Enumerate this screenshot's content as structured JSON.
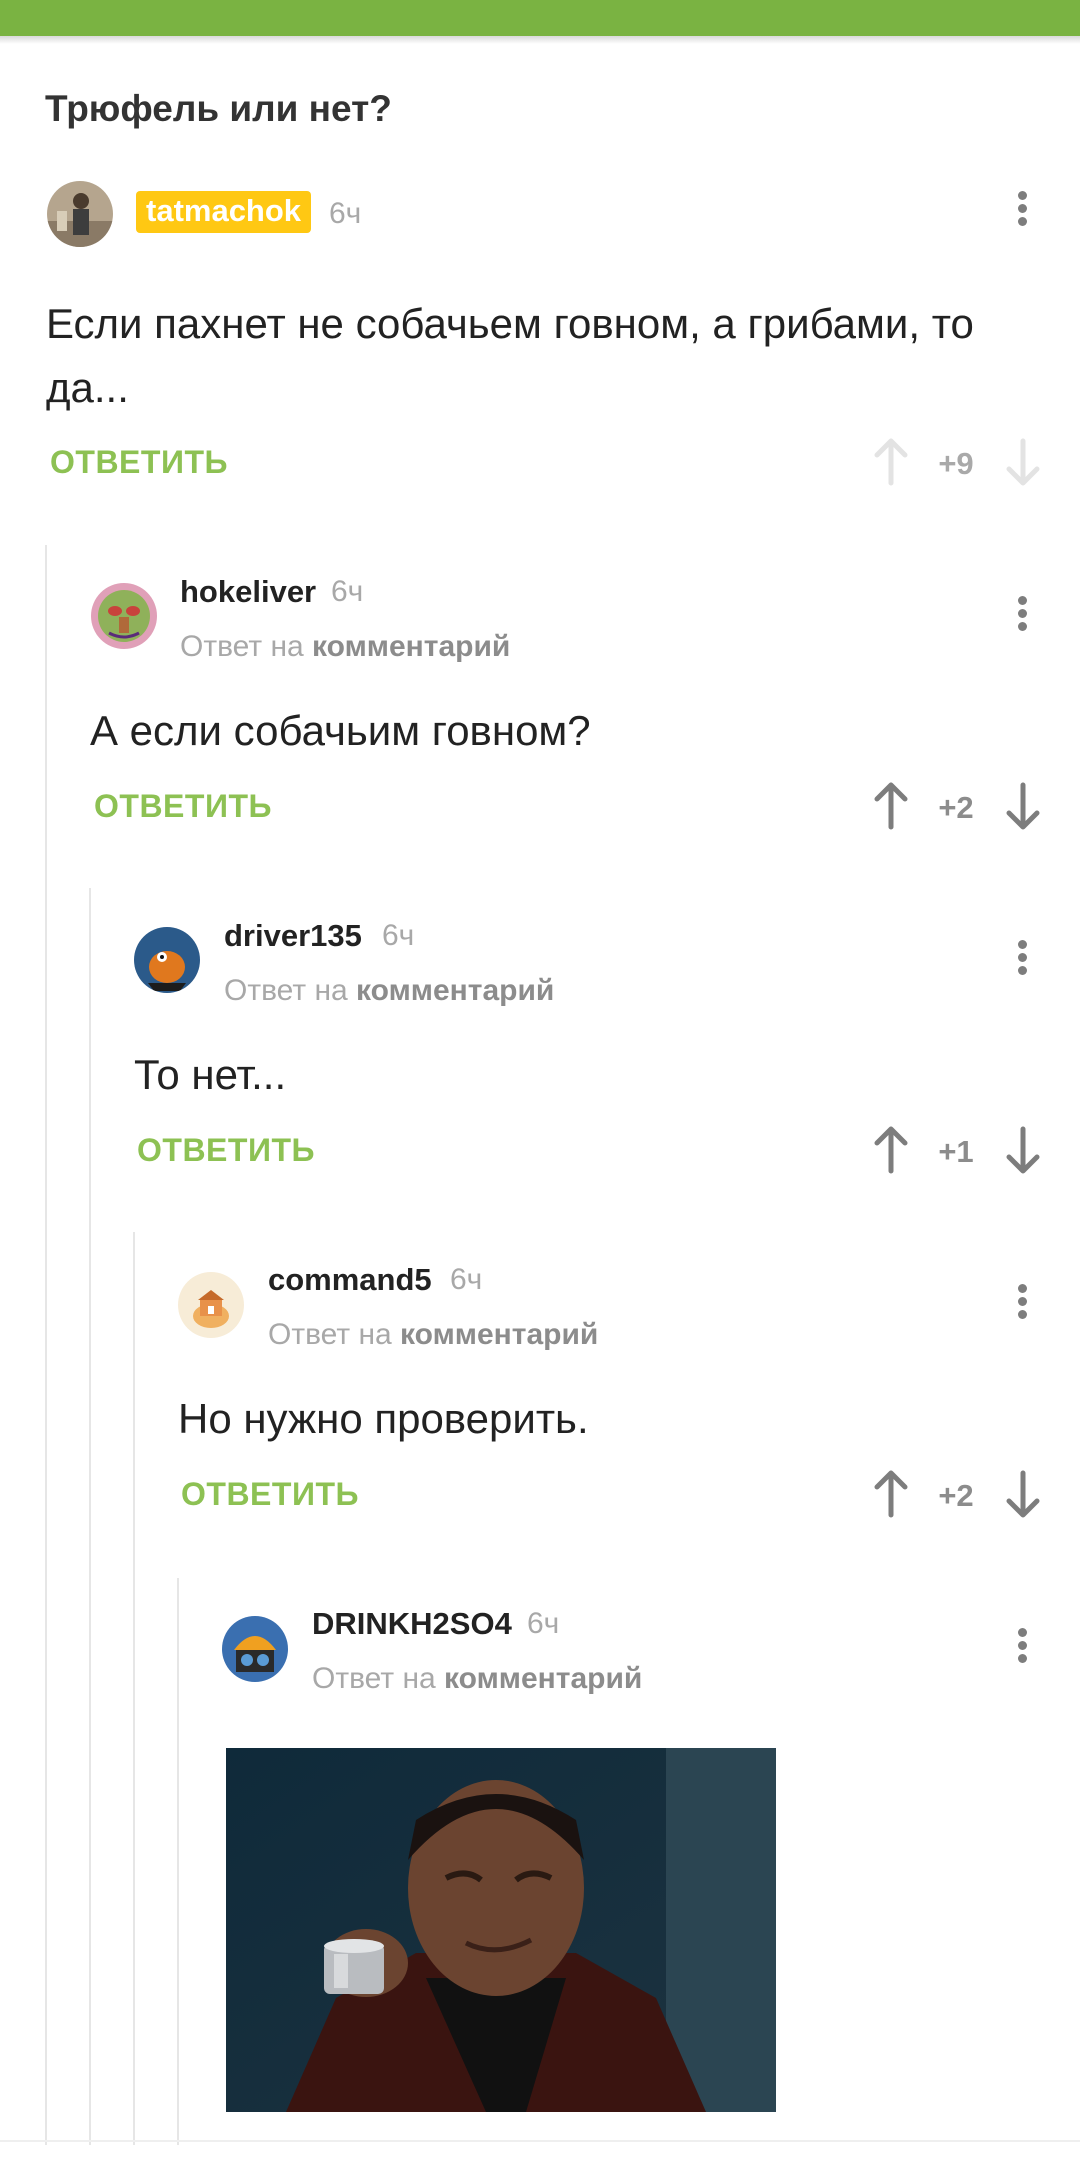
{
  "post": {
    "title": "Трюфель или нет?"
  },
  "comments": [
    {
      "author": "tatmachok",
      "time": "6ч",
      "text": "Если пахнет не собачьем говном, а грибами, то да...",
      "reply_label": "ОТВЕТИТЬ",
      "score": "+9"
    },
    {
      "author": "hokeliver",
      "time": "6ч",
      "reply_to_prefix": "Ответ на",
      "reply_to_link": "комментарий",
      "text": "А если собачьим говном?",
      "reply_label": "ОТВЕТИТЬ",
      "score": "+2"
    },
    {
      "author": "driver135",
      "time": "6ч",
      "reply_to_prefix": "Ответ на",
      "reply_to_link": "комментарий",
      "text": "То нет...",
      "reply_label": "ОТВЕТИТЬ",
      "score": "+1"
    },
    {
      "author": "command5",
      "time": "6ч",
      "reply_to_prefix": "Ответ на",
      "reply_to_link": "комментарий",
      "text": "Но нужно проверить.",
      "reply_label": "ОТВЕТИТЬ",
      "score": "+2"
    },
    {
      "author": "DRINKH2SO4",
      "time": "6ч",
      "reply_to_prefix": "Ответ на",
      "reply_to_link": "комментарий"
    }
  ],
  "colors": {
    "accent_green": "#7ab342",
    "reply_green": "#8dc153",
    "badge_yellow": "#ffc813"
  },
  "icons": [
    "more-vertical-icon",
    "arrow-up-icon",
    "arrow-down-icon"
  ]
}
